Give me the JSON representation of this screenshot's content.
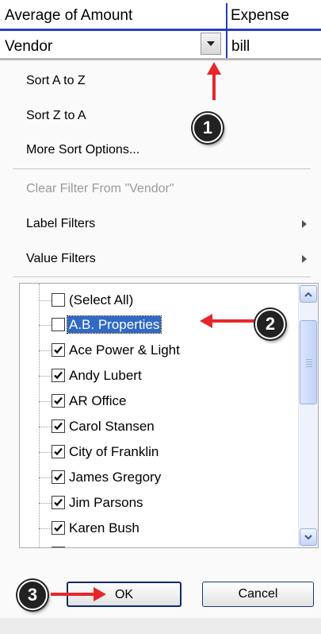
{
  "header": {
    "col1_title": "Average of Amount",
    "col2_title": "Expense",
    "row_field": "Vendor",
    "row_value": "bill"
  },
  "menu": {
    "sort_az": "Sort A to Z",
    "sort_za": "Sort Z to A",
    "more_sort": "More Sort Options...",
    "clear_filter": "Clear Filter From \"Vendor\"",
    "label_filters": "Label Filters",
    "value_filters": "Value Filters"
  },
  "list": {
    "items": [
      {
        "label": "(Select All)",
        "checked": false
      },
      {
        "label": "A.B. Properties",
        "checked": false
      },
      {
        "label": "Ace Power & Light",
        "checked": true
      },
      {
        "label": "Andy Lubert",
        "checked": true
      },
      {
        "label": "AR Office",
        "checked": true
      },
      {
        "label": "Carol Stansen",
        "checked": true
      },
      {
        "label": "City of Franklin",
        "checked": true
      },
      {
        "label": "James Gregory",
        "checked": true
      },
      {
        "label": "Jim Parsons",
        "checked": true
      },
      {
        "label": "Karen Bush",
        "checked": true
      }
    ]
  },
  "buttons": {
    "ok": "OK",
    "cancel": "Cancel"
  },
  "annotations": {
    "badge1": "1",
    "badge2": "2",
    "badge3": "3",
    "arrow_color": "#e8262a"
  }
}
